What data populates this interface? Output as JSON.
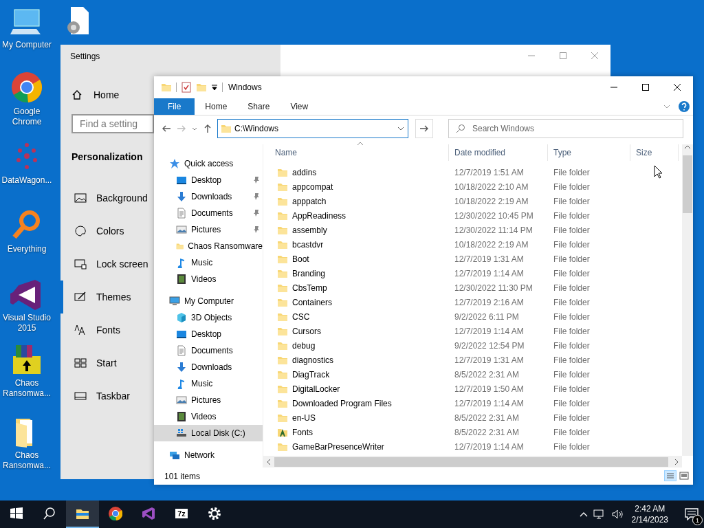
{
  "desktop_icons": [
    {
      "kind": "computer",
      "label": "My Computer"
    },
    {
      "kind": "settings-file"
    },
    {
      "kind": "chrome",
      "label": "Google Chrome"
    },
    {
      "kind": "dots",
      "label": "DataWagon..."
    },
    {
      "kind": "magnifier",
      "label": "Everything"
    },
    {
      "kind": "vs",
      "label": "Visual Studio 2015"
    },
    {
      "kind": "archive",
      "label": "Chaos Ransomwa..."
    },
    {
      "kind": "folder-doc",
      "label": "Chaos Ransomwa..."
    }
  ],
  "settings_window": {
    "title": "Settings",
    "home": "Home",
    "search": {
      "placeholder": "Find a setting"
    },
    "section": "Personalization",
    "items": [
      {
        "kind": "picture",
        "label": "Background",
        "selected": false
      },
      {
        "kind": "palette",
        "label": "Colors",
        "selected": false
      },
      {
        "kind": "lock",
        "label": "Lock screen",
        "selected": false
      },
      {
        "kind": "brush",
        "label": "Themes",
        "selected": true
      },
      {
        "kind": "fonts",
        "label": "Fonts",
        "selected": false
      },
      {
        "kind": "tiles",
        "label": "Start",
        "selected": false
      },
      {
        "kind": "taskbar",
        "label": "Taskbar",
        "selected": false
      }
    ]
  },
  "explorer": {
    "title": "Windows",
    "tabs": [
      {
        "label": "File",
        "selected": true
      },
      {
        "label": "Home",
        "selected": false
      },
      {
        "label": "Share",
        "selected": false
      },
      {
        "label": "View",
        "selected": false
      }
    ],
    "address": "C:\\Windows",
    "search": {
      "placeholder": "Search Windows"
    },
    "nav": [
      {
        "kind": "star",
        "label": "Quick access",
        "selected": false,
        "children": [
          {
            "kind": "desktop",
            "label": "Desktop",
            "pinned": true,
            "selected": false
          },
          {
            "kind": "download",
            "label": "Downloads",
            "pinned": true,
            "selected": false
          },
          {
            "kind": "document",
            "label": "Documents",
            "pinned": true,
            "selected": false
          },
          {
            "kind": "pictures",
            "label": "Pictures",
            "pinned": true,
            "selected": false
          },
          {
            "kind": "folder",
            "label": "Chaos Ransomware",
            "pinned": false,
            "selected": false
          },
          {
            "kind": "music",
            "label": "Music",
            "pinned": false,
            "selected": false
          },
          {
            "kind": "video",
            "label": "Videos",
            "pinned": false,
            "selected": false
          }
        ]
      },
      {
        "kind": "computer",
        "label": "My Computer",
        "selected": false,
        "children": [
          {
            "kind": "cube",
            "label": "3D Objects",
            "pinned": false,
            "selected": false
          },
          {
            "kind": "desktop",
            "label": "Desktop",
            "pinned": false,
            "selected": false
          },
          {
            "kind": "document",
            "label": "Documents",
            "pinned": false,
            "selected": false
          },
          {
            "kind": "download",
            "label": "Downloads",
            "pinned": false,
            "selected": false
          },
          {
            "kind": "music",
            "label": "Music",
            "pinned": false,
            "selected": false
          },
          {
            "kind": "pictures",
            "label": "Pictures",
            "pinned": false,
            "selected": false
          },
          {
            "kind": "video",
            "label": "Videos",
            "pinned": false,
            "selected": false
          },
          {
            "kind": "disk",
            "label": "Local Disk (C:)",
            "pinned": false,
            "selected": true
          }
        ]
      },
      {
        "kind": "network",
        "label": "Network",
        "selected": false
      }
    ],
    "columns": [
      "Name",
      "Date modified",
      "Type",
      "Size"
    ],
    "rows": [
      {
        "kind": "folder",
        "name": "addins",
        "date": "12/7/2019 1:51 AM",
        "type": "File folder"
      },
      {
        "kind": "folder",
        "name": "appcompat",
        "date": "10/18/2022 2:10 AM",
        "type": "File folder"
      },
      {
        "kind": "folder",
        "name": "apppatch",
        "date": "10/18/2022 2:19 AM",
        "type": "File folder"
      },
      {
        "kind": "folder",
        "name": "AppReadiness",
        "date": "12/30/2022 10:45 PM",
        "type": "File folder"
      },
      {
        "kind": "folder",
        "name": "assembly",
        "date": "12/30/2022 11:14 PM",
        "type": "File folder"
      },
      {
        "kind": "folder",
        "name": "bcastdvr",
        "date": "10/18/2022 2:19 AM",
        "type": "File folder"
      },
      {
        "kind": "folder",
        "name": "Boot",
        "date": "12/7/2019 1:31 AM",
        "type": "File folder"
      },
      {
        "kind": "folder",
        "name": "Branding",
        "date": "12/7/2019 1:14 AM",
        "type": "File folder"
      },
      {
        "kind": "folder",
        "name": "CbsTemp",
        "date": "12/30/2022 11:30 PM",
        "type": "File folder"
      },
      {
        "kind": "folder",
        "name": "Containers",
        "date": "12/7/2019 2:16 AM",
        "type": "File folder"
      },
      {
        "kind": "folder",
        "name": "CSC",
        "date": "9/2/2022 6:11 PM",
        "type": "File folder"
      },
      {
        "kind": "folder",
        "name": "Cursors",
        "date": "12/7/2019 1:14 AM",
        "type": "File folder"
      },
      {
        "kind": "folder",
        "name": "debug",
        "date": "9/2/2022 12:54 PM",
        "type": "File folder"
      },
      {
        "kind": "folder",
        "name": "diagnostics",
        "date": "12/7/2019 1:31 AM",
        "type": "File folder"
      },
      {
        "kind": "folder",
        "name": "DiagTrack",
        "date": "8/5/2022 2:31 AM",
        "type": "File folder"
      },
      {
        "kind": "folder",
        "name": "DigitalLocker",
        "date": "12/7/2019 1:50 AM",
        "type": "File folder"
      },
      {
        "kind": "folder",
        "name": "Downloaded Program Files",
        "date": "12/7/2019 1:14 AM",
        "type": "File folder"
      },
      {
        "kind": "folder",
        "name": "en-US",
        "date": "8/5/2022 2:31 AM",
        "type": "File folder"
      },
      {
        "kind": "fonts",
        "name": "Fonts",
        "date": "8/5/2022 2:31 AM",
        "type": "File folder"
      },
      {
        "kind": "folder",
        "name": "GameBarPresenceWriter",
        "date": "12/7/2019 1:14 AM",
        "type": "File folder"
      }
    ],
    "status": "101 items"
  },
  "taskbar": {
    "apps": [
      {
        "kind": "start",
        "selected": false
      },
      {
        "kind": "search",
        "selected": false
      },
      {
        "kind": "explorer",
        "selected": true
      },
      {
        "kind": "chrome",
        "selected": false
      },
      {
        "kind": "vs",
        "selected": false
      },
      {
        "kind": "sevenzip",
        "label": "7z",
        "selected": false
      },
      {
        "kind": "gear",
        "selected": false
      }
    ],
    "time": "2:42 AM",
    "date": "2/14/2023",
    "notifications": "1"
  }
}
